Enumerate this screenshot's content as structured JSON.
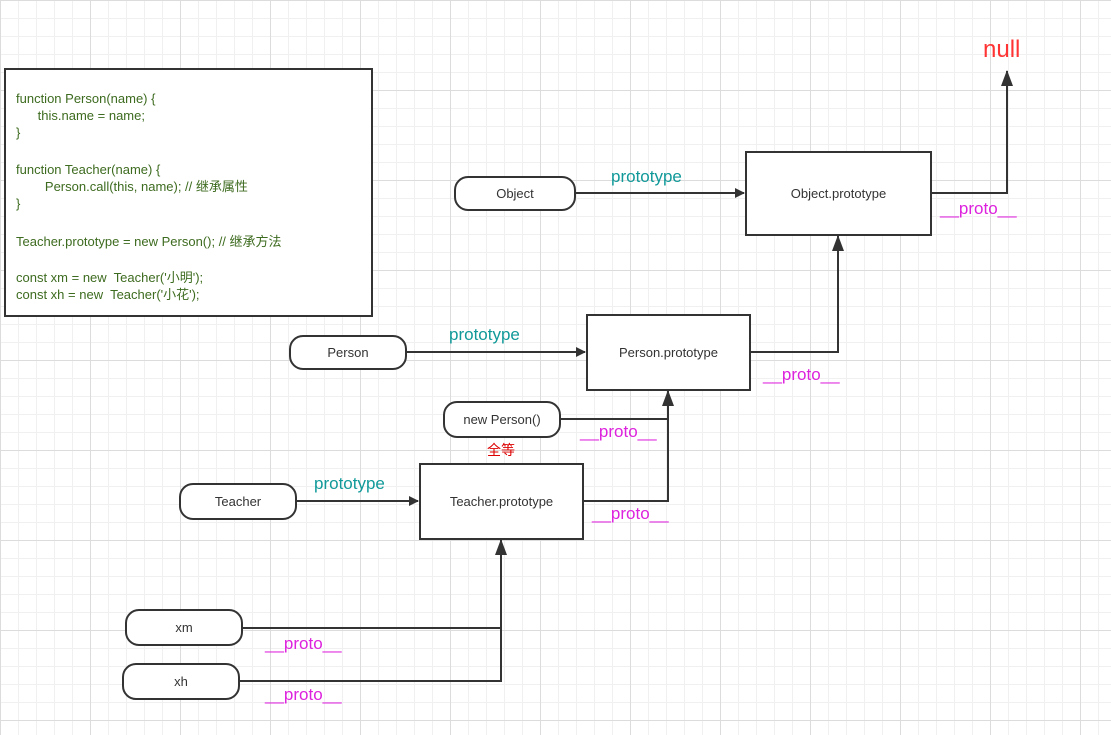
{
  "code_lines": [
    "function Person(name) {",
    "      this.name = name;",
    "}",
    "",
    "function Teacher(name) {",
    "        Person.call(this, name); // 继承属性",
    "}",
    "",
    "Teacher.prototype = new Person(); // 继承方法",
    "",
    "const xm = new  Teacher('小明');",
    "const xh = new  Teacher('小花');"
  ],
  "nodes": {
    "object": "Object",
    "object_prototype": "Object.prototype",
    "person": "Person",
    "person_prototype": "Person.prototype",
    "new_person": "new Person()",
    "teacher": "Teacher",
    "teacher_prototype": "Teacher.prototype",
    "xm": "xm",
    "xh": "xh"
  },
  "labels": {
    "null": "null",
    "prototype": "prototype",
    "proto": "__proto__",
    "equal": "全等"
  },
  "colors": {
    "prototype": "#119999",
    "proto": "#dd22dd",
    "null": "#ff3333",
    "equal": "#dd0000",
    "code": "#3d6b1f"
  }
}
